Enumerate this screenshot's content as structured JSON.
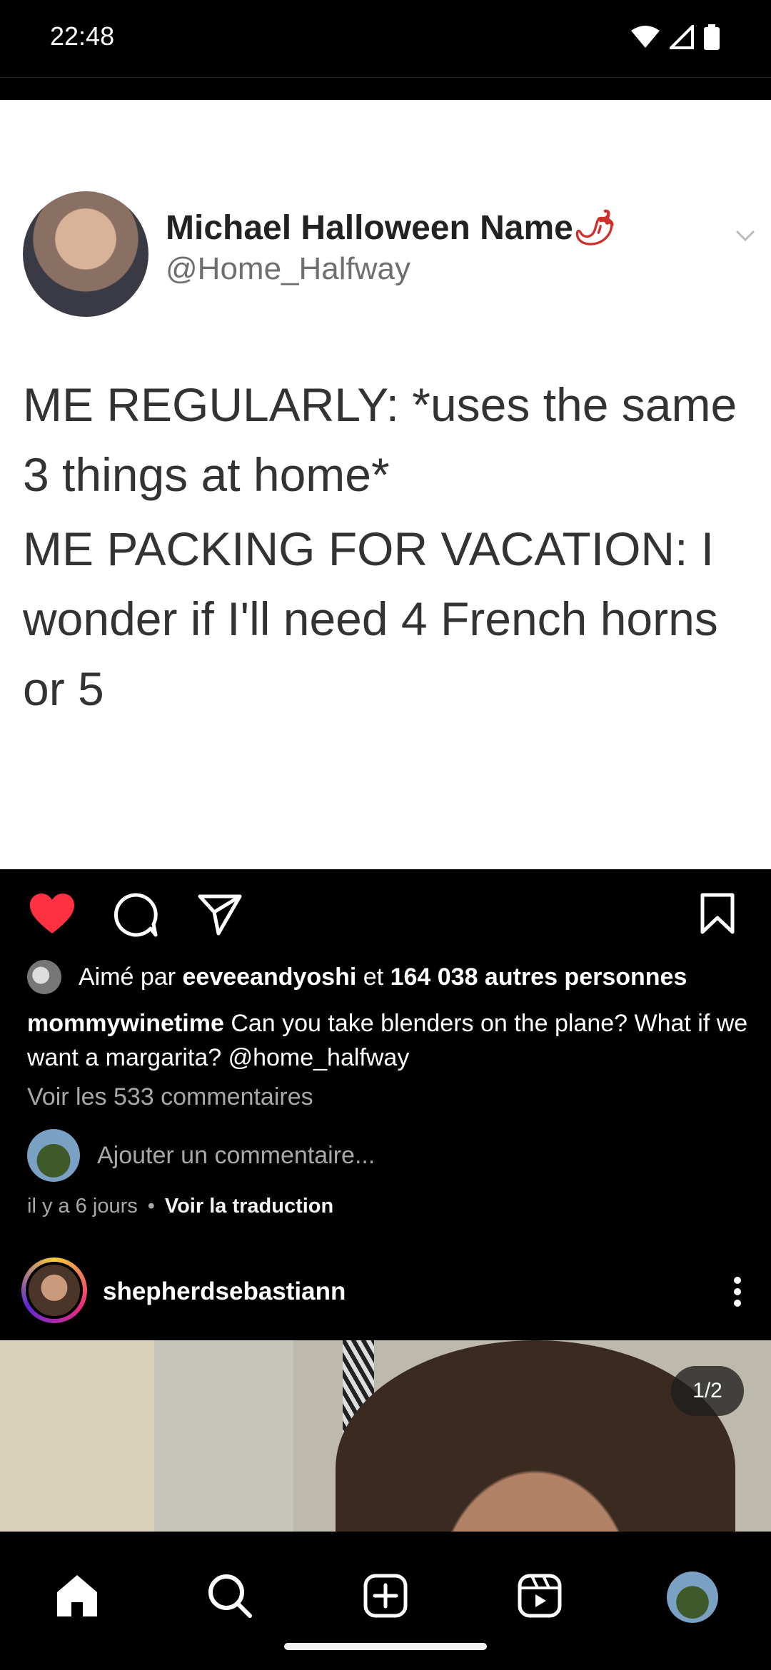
{
  "status_bar": {
    "time": "22:48"
  },
  "tweet": {
    "name": "Michael Halloween Name",
    "emoji": "🌶",
    "handle": "@Home_Halfway",
    "line1": "ME REGULARLY: *uses the same 3 things at home*",
    "line2": "ME PACKING FOR VACATION: I wonder if I'll need 4 French horns or 5"
  },
  "post": {
    "liked": true,
    "likes": {
      "prefix": "Aimé par",
      "first_user": "eeveeandyoshi",
      "conjunction": "et",
      "others": "164 038 autres personnes"
    },
    "caption": {
      "username": "mommywinetime",
      "text": "Can you take blenders on the plane? What if we want a margarita? @home_halfway"
    },
    "view_comments": "Voir les 533 commentaires",
    "add_comment_placeholder": "Ajouter un commentaire...",
    "time_ago": "il y a 6 jours",
    "separator": "•",
    "see_translation": "Voir la traduction"
  },
  "next_post": {
    "username": "shepherdsebastiann",
    "carousel_counter": "1/2"
  },
  "colors": {
    "like_red": "#ff3040",
    "background": "#000000"
  }
}
